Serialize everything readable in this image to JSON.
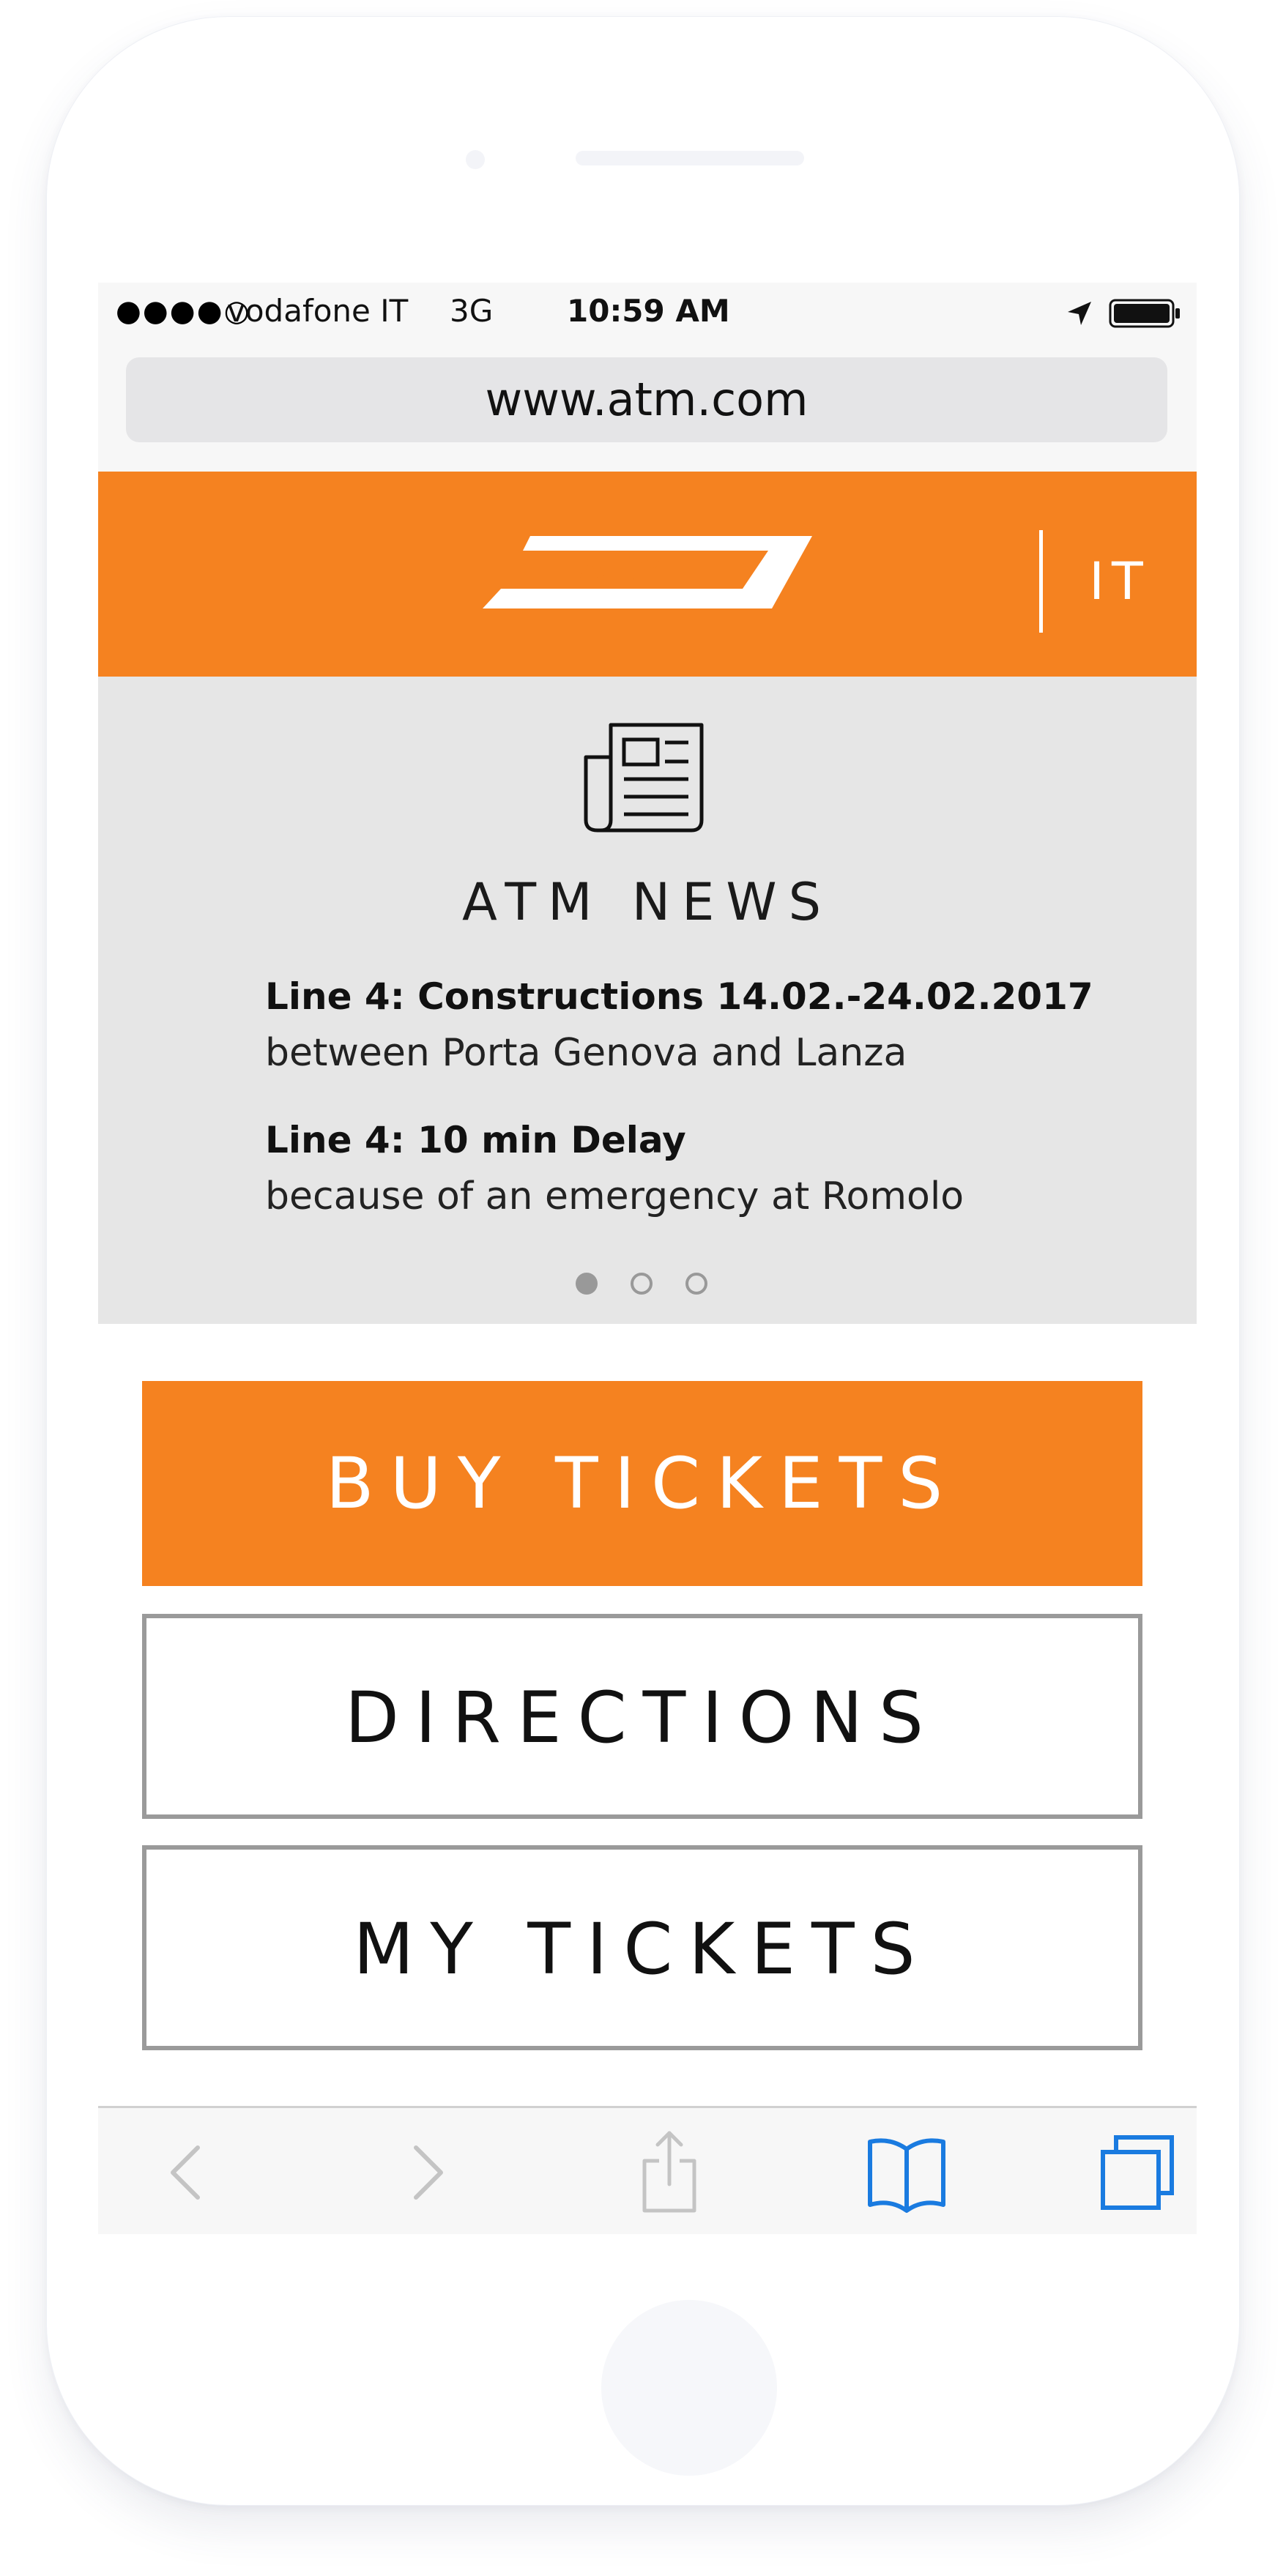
{
  "status_bar": {
    "signal": "●●●●○",
    "carrier": "vodafone IT",
    "network": "3G",
    "time": "10:59 AM"
  },
  "browser": {
    "url": "www.atm.com"
  },
  "header": {
    "logo_text": "ATM",
    "language": "IT",
    "brand_color": "#f58220"
  },
  "news": {
    "title": "ATM NEWS",
    "items": [
      {
        "headline": "Line 4: Constructions 14.02.-24.02.2017",
        "detail": "between Porta Genova and Lanza"
      },
      {
        "headline": "Line 4: 10 min Delay",
        "detail": "because of an emergency at Romolo"
      }
    ],
    "pages": 3,
    "active_page": 1
  },
  "actions": {
    "buy_tickets": "BUY TICKETS",
    "directions": "DIRECTIONS",
    "my_tickets": "MY TICKETS"
  },
  "toolbar": {
    "icons": [
      "back-icon",
      "forward-icon",
      "share-icon",
      "bookmarks-icon",
      "tabs-icon"
    ],
    "accent_color": "#1a7be0"
  }
}
